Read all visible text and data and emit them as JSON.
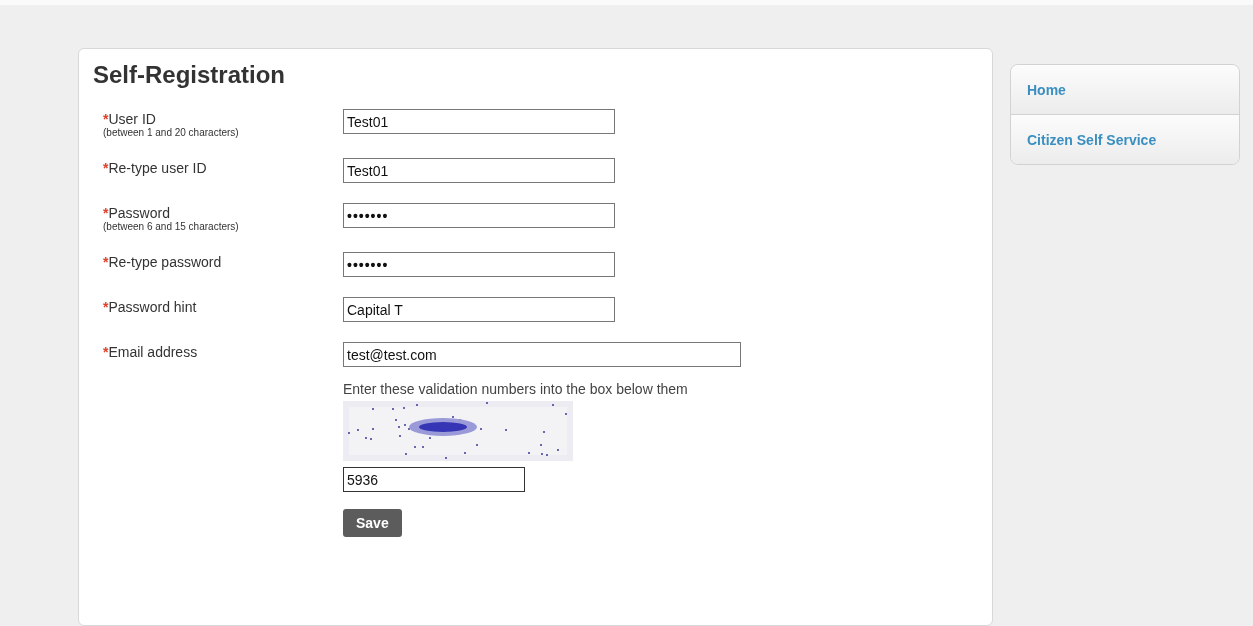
{
  "page": {
    "title": "Self-Registration"
  },
  "fields": [
    {
      "required_mark": "*",
      "label": "User ID",
      "hint": "(between 1 and 20 characters)",
      "value": "Test01",
      "kind": "short"
    },
    {
      "required_mark": "*",
      "label": "Re-type user ID",
      "value": "Test01",
      "kind": "short"
    },
    {
      "required_mark": "*",
      "label": "Password",
      "hint": "(between 6 and 15 characters)",
      "value": "•••••••",
      "kind": "secret"
    },
    {
      "required_mark": "*",
      "label": "Re-type password",
      "value": "•••••••",
      "kind": "secret"
    },
    {
      "required_mark": "*",
      "label": "Password hint",
      "value": "Capital T",
      "kind": "short"
    },
    {
      "required_mark": "*",
      "label": "Email address",
      "value": "test@test.com",
      "kind": "long"
    }
  ],
  "validation": {
    "instruction": "Enter these validation numbers into the box below them",
    "value": "5936"
  },
  "save_button": "Save",
  "sidebar": {
    "items": [
      {
        "label": "Home"
      },
      {
        "label": "Citizen Self Service"
      }
    ]
  }
}
